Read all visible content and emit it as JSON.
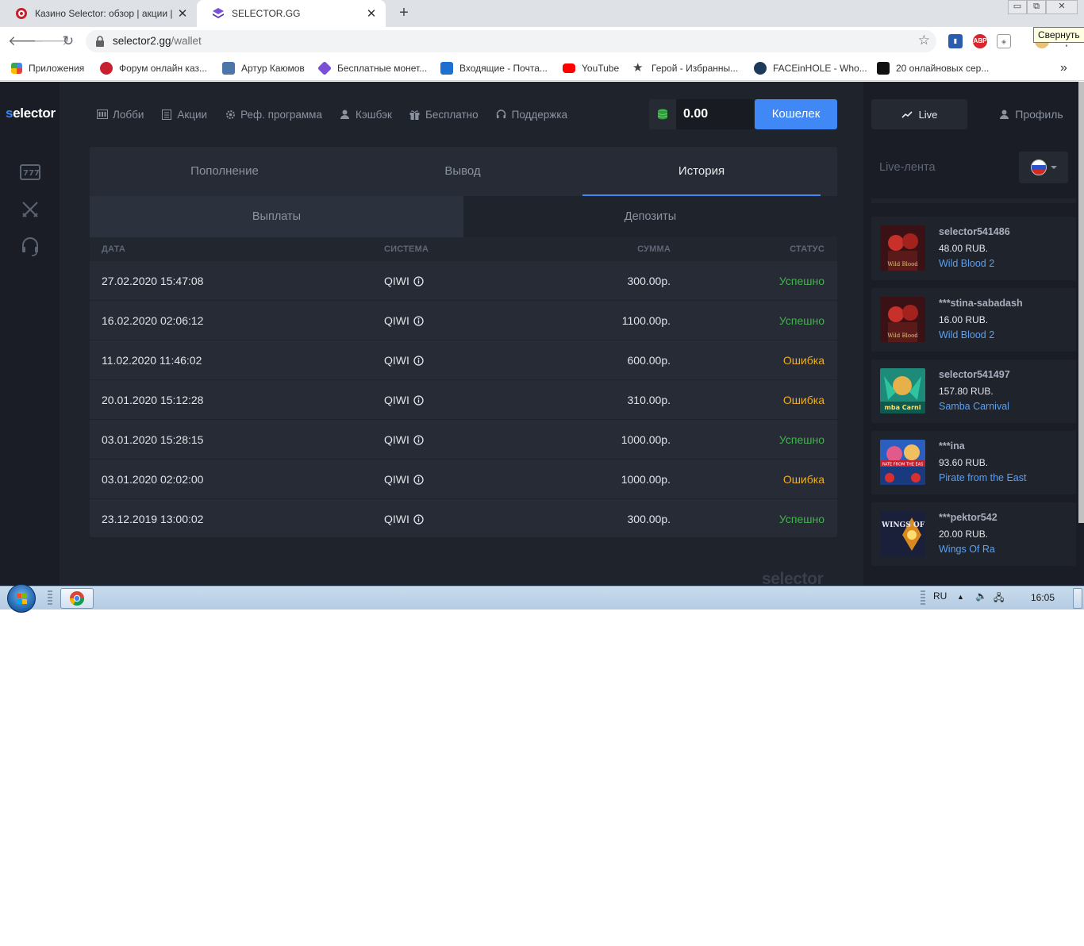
{
  "browser": {
    "tabs": [
      {
        "title": "Казино Selector: обзор | акции | ",
        "active": false
      },
      {
        "title": "SELECTOR.GG",
        "active": true
      }
    ],
    "new_tab": "+",
    "close": "✕",
    "window_controls": {
      "minimize": "▭",
      "restore": "⧉",
      "close": "✕"
    },
    "tooltip": "Свернуть",
    "url_host": "selector2.gg",
    "url_path": "/wallet",
    "bookmarks": [
      "Приложения",
      "Форум онлайн каз...",
      "Артур Каюмов",
      "Бесплатные монет...",
      "Входящие - Почта...",
      "YouTube",
      "Герой - Избранны...",
      "FACEinHOLE - Who...",
      "20 онлайновых сер..."
    ],
    "more": "»"
  },
  "site": {
    "logo_s": "s",
    "logo_rest": "elector",
    "nav": [
      "Лобби",
      "Акции",
      "Реф. программа",
      "Кэшбэк",
      "Бесплатно",
      "Поддержка"
    ],
    "balance": "0.00",
    "wallet_button": "Кошелек",
    "tabs": [
      "Пополнение",
      "Вывод",
      "История"
    ],
    "active_tab": "История",
    "subtabs": [
      "Выплаты",
      "Депозиты"
    ],
    "columns": {
      "date": "ДАТА",
      "system": "СИСТЕМА",
      "sum": "СУММА",
      "status": "СТАТУС"
    },
    "rows": [
      {
        "date": "27.02.2020 15:47:08",
        "system": "QIWI",
        "sum": "300.00р.",
        "status": "Успешно",
        "ok": true
      },
      {
        "date": "16.02.2020 02:06:12",
        "system": "QIWI",
        "sum": "1100.00р.",
        "status": "Успешно",
        "ok": true
      },
      {
        "date": "11.02.2020 11:46:02",
        "system": "QIWI",
        "sum": "600.00р.",
        "status": "Ошибка",
        "ok": false
      },
      {
        "date": "20.01.2020 15:12:28",
        "system": "QIWI",
        "sum": "310.00р.",
        "status": "Ошибка",
        "ok": false
      },
      {
        "date": "03.01.2020 15:28:15",
        "system": "QIWI",
        "sum": "1000.00р.",
        "status": "Успешно",
        "ok": true
      },
      {
        "date": "03.01.2020 02:02:00",
        "system": "QIWI",
        "sum": "1000.00р.",
        "status": "Ошибка",
        "ok": false
      },
      {
        "date": "23.12.2019 13:00:02",
        "system": "QIWI",
        "sum": "300.00р.",
        "status": "Успешно",
        "ok": true
      }
    ],
    "footer_logo": "selector",
    "colors": {
      "accent": "#3f88f5",
      "success": "#3fb54a",
      "error": "#f0b020",
      "link": "#58a1f7"
    }
  },
  "sidebar": {
    "live_button": "Live",
    "profile_button": "Профиль",
    "feed_title": "Live-лента",
    "feed": [
      {
        "user": "selector541486",
        "amount": "48.00 RUB.",
        "game": "Wild Blood 2",
        "thumb": "wild"
      },
      {
        "user": "***stina-sabadash",
        "amount": "16.00 RUB.",
        "game": "Wild Blood 2",
        "thumb": "wild"
      },
      {
        "user": "selector541497",
        "amount": "157.80 RUB.",
        "game": "Samba Carnival",
        "thumb": "samba"
      },
      {
        "user": "***ina",
        "amount": "93.60 RUB.",
        "game": "Pirate from the East",
        "thumb": "pirate"
      },
      {
        "user": "***pektor542",
        "amount": "20.00 RUB.",
        "game": "Wings Of Ra",
        "thumb": "ra"
      }
    ],
    "thumb_labels": {
      "wild": "Wild Blood",
      "samba": "mba Carni",
      "pirate": "RATE FROM THE EAS",
      "ra": "WINGS OF RA"
    }
  },
  "taskbar": {
    "lang": "RU",
    "time": "16:05"
  }
}
